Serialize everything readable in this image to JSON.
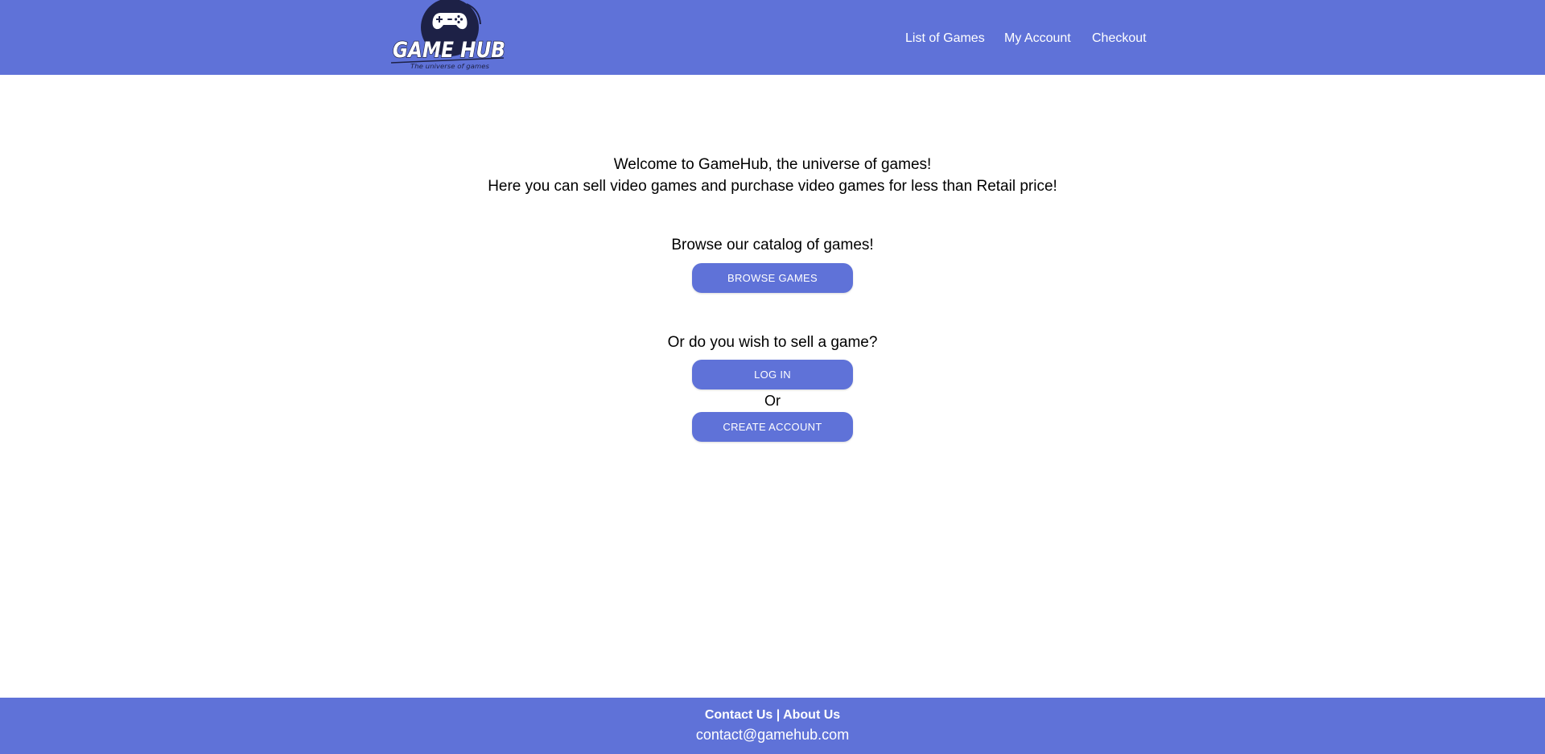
{
  "header": {
    "logo": {
      "title": "GAME HUB",
      "tagline": "The universe of games"
    },
    "nav": [
      {
        "label": "List of Games"
      },
      {
        "label": "My Account"
      },
      {
        "label": "Checkout"
      }
    ]
  },
  "main": {
    "welcome_line1": "Welcome to GameHub, the universe of games!",
    "welcome_line2": "Here you can sell video games and purchase video games for less than Retail price!",
    "browse_title": "Browse our catalog of games!",
    "browse_button": "BROWSE GAMES",
    "sell_title": "Or do you wish to sell a game?",
    "login_button": "LOG IN",
    "or_text": "Or",
    "create_button": "CREATE ACCOUNT"
  },
  "footer": {
    "contact_link": "Contact Us",
    "separator": "|",
    "about_link": "About Us",
    "email": "contact@gamehub.com"
  },
  "colors": {
    "brand": "#5f72d8",
    "logo_dark": "#1d2146",
    "text": "#000000",
    "on_brand": "#ffffff"
  }
}
